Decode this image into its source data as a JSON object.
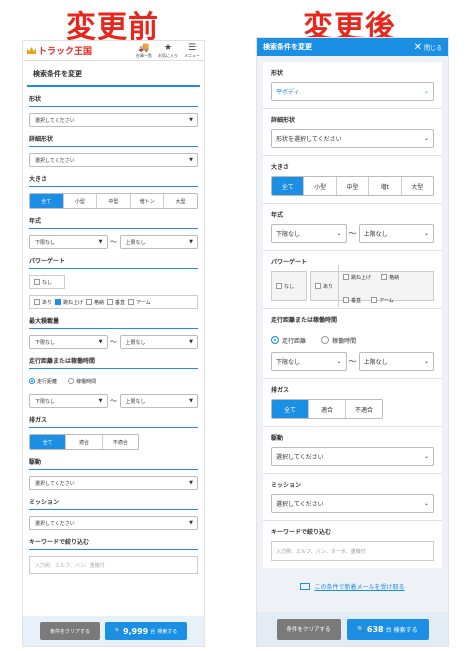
{
  "headings": {
    "before": "変更前",
    "after": "変更後"
  },
  "before": {
    "logo": "トラック王国",
    "header_icons": [
      {
        "icon": "truck-icon",
        "label": "在庫一覧"
      },
      {
        "icon": "star-icon",
        "label": "お気に入り"
      },
      {
        "icon": "menu-icon",
        "label": "メニュー"
      }
    ],
    "title": "検索条件を変更",
    "shape": {
      "label": "形状",
      "value": "選択してください"
    },
    "detail_shape": {
      "label": "詳細形状",
      "value": "選択してください"
    },
    "size": {
      "label": "大きさ",
      "options": [
        "全て",
        "小型",
        "中型",
        "増トン",
        "大型"
      ],
      "selected": "全て"
    },
    "year": {
      "label": "年式",
      "from": "下限なし",
      "to": "上限なし",
      "sep": "〜"
    },
    "power_gate": {
      "label": "パワーゲート",
      "none": "なし",
      "options": [
        "あり",
        "跳ね上げ",
        "格納",
        "垂直",
        "アーム"
      ]
    },
    "max_load": {
      "label": "最大積載量",
      "from": "下限なし",
      "to": "上限なし",
      "sep": "〜"
    },
    "mileage": {
      "label": "走行距離または稼働時間",
      "radios": [
        "走行距離",
        "稼働時間"
      ],
      "from": "下限なし",
      "to": "上限なし",
      "sep": "〜"
    },
    "emission": {
      "label": "排ガス",
      "options": [
        "全て",
        "適合",
        "不適合"
      ]
    },
    "drive": {
      "label": "駆動",
      "value": "選択してください"
    },
    "mission": {
      "label": "ミッション",
      "value": "選択してください"
    },
    "keyword": {
      "label": "キーワードで絞り込む",
      "placeholder": "入力例：エルフ、バン、重機付"
    },
    "footer": {
      "clear": "条件をクリアする",
      "count": "9,999",
      "unit": "台",
      "search": "検索する"
    }
  },
  "after": {
    "title": "検索条件を変更",
    "close": "閉じる",
    "shape": {
      "label": "形状",
      "value": "平ボディ"
    },
    "detail_shape": {
      "label": "詳細形状",
      "value": "形状を選択してください"
    },
    "size": {
      "label": "大きさ",
      "options": [
        "全て",
        "小型",
        "中型",
        "増t",
        "大型"
      ],
      "selected": "全て"
    },
    "year": {
      "label": "年式",
      "from": "下限なし",
      "to": "上限なし",
      "sep": "〜"
    },
    "power_gate": {
      "label": "パワーゲート",
      "none": "なし",
      "ari": "あり",
      "options": [
        "跳ね上げ",
        "格納",
        "垂直",
        "アーム"
      ]
    },
    "mileage": {
      "label": "走行距離または稼働時間",
      "radios": [
        "走行距離",
        "稼働時間"
      ],
      "from": "下限なし",
      "to": "上限なし",
      "sep": "〜"
    },
    "emission": {
      "label": "排ガス",
      "options": [
        "全て",
        "適合",
        "不適合"
      ]
    },
    "drive": {
      "label": "駆動",
      "value": "選択してください"
    },
    "mission": {
      "label": "ミッション",
      "value": "選択してください"
    },
    "keyword": {
      "label": "キーワードで絞り込む",
      "placeholder": "入力例：エルフ、バン、ターボ、重機付"
    },
    "mail": "この条件で新着メールを受け取る",
    "footer": {
      "clear": "条件をクリアする",
      "count": "638",
      "unit": "台",
      "search": "検索する"
    }
  },
  "colors": {
    "accent": "#1a8fe3",
    "heading": "#e8261c",
    "clear_button": "#7a7a7a"
  }
}
